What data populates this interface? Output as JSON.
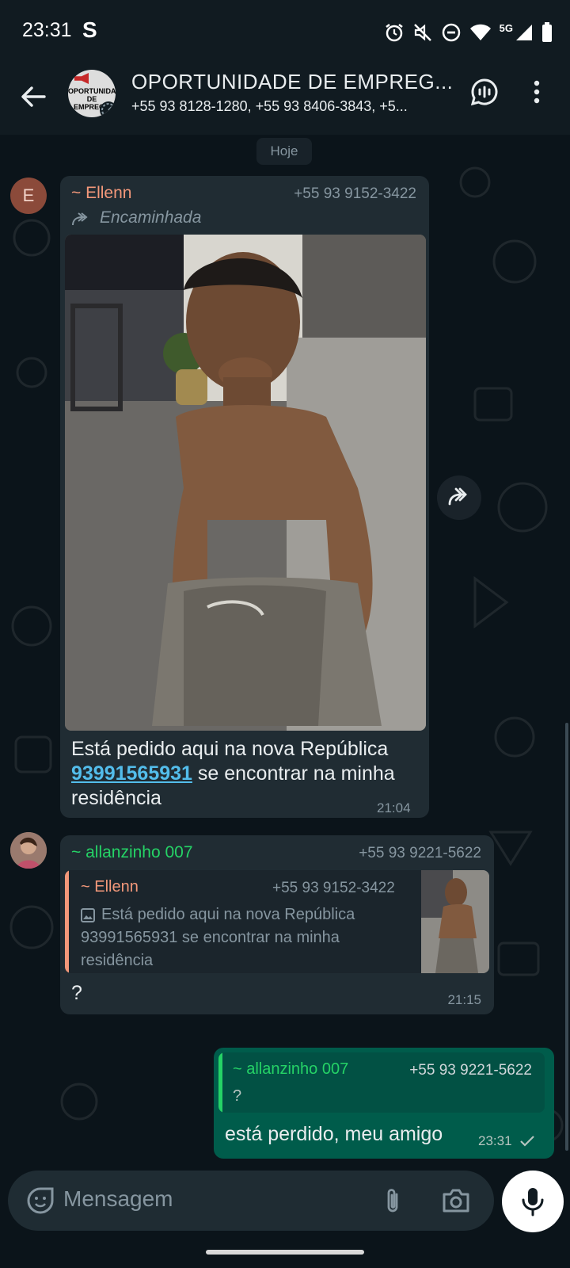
{
  "status_bar": {
    "time": "23:31",
    "app_letter": "S",
    "network": "5G"
  },
  "header": {
    "title": "OPORTUNIDADE DE EMPREG...",
    "subtitle": "+55 93 8128-1280, +55 93 8406-3843, +5...",
    "avatar_text": "OPORTUNIDADE DE EMPREGO"
  },
  "chat": {
    "date_label": "Hoje",
    "messages": [
      {
        "avatar_letter": "E",
        "sender": "~ Ellenn",
        "phone": "+55 93 9152-3422",
        "forwarded_label": "Encaminhada",
        "text_part1": "Está pedido aqui na nova República ",
        "link": "93991565931",
        "text_part2": " se encontrar na minha residência",
        "time": "21:04"
      },
      {
        "sender": "~ allanzinho 007",
        "phone": "+55 93 9221-5622",
        "quote_sender": "~ Ellenn",
        "quote_phone": "+55 93 9152-3422",
        "quote_text": "Está pedido aqui na nova República 93991565931 se encontrar na minha residência",
        "text": "?",
        "time": "21:15"
      },
      {
        "quote_sender": "~ allanzinho 007",
        "quote_phone": "+55 93 9221-5622",
        "quote_text": "?",
        "text": "está perdido, meu amigo",
        "time": "23:31"
      }
    ]
  },
  "input": {
    "placeholder": "Mensagem"
  },
  "colors": {
    "header_bg": "#111b21",
    "chat_bg": "#0b141a",
    "incoming": "#202c33",
    "outgoing": "#005c4b",
    "accent_green": "#25d366",
    "ellenn_name": "#f3987a",
    "link": "#53bdeb"
  }
}
